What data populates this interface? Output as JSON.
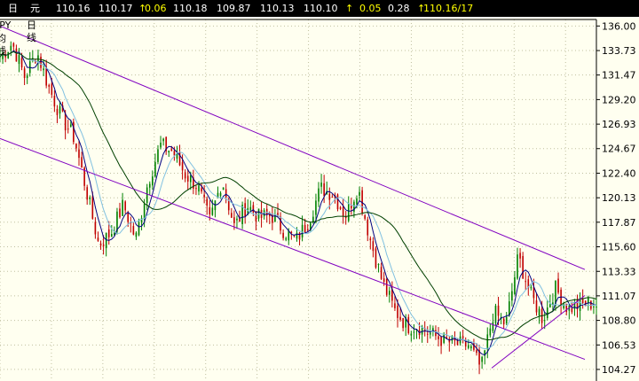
{
  "toolbar": {
    "period_glyph": "日",
    "currency_glyph": "元",
    "open": "110.16",
    "high": "110.17",
    "change_arrow": "↑",
    "change": "0.06",
    "prev": "110.18",
    "low": "109.87",
    "bid": "110.13",
    "ask": "110.10",
    "arrow2": "↑",
    "chg2": "0.05",
    "pct": "0.28",
    "arrow3": "↑",
    "last": "110.16/17"
  },
  "subheader": {
    "symbol": "JPY",
    "period": "日线",
    "ma_label": "均线"
  },
  "colors": {
    "background": "#FFFFF0",
    "up_candle": "#008000",
    "down_candle": "#C00000",
    "channel": "#8000C0",
    "ma_short": "#000080",
    "ma_medium": "#80C0E0",
    "ma_long": "#004000",
    "grid": "#C0C0A0",
    "toolbar_bg": "#000000",
    "toolbar_up": "#FFFF00"
  },
  "chart_data": {
    "type": "candlestick",
    "ylim": [
      103.2,
      136.6
    ],
    "y_ticks": [
      "136.00",
      "133.73",
      "131.47",
      "129.20",
      "126.93",
      "124.67",
      "122.40",
      "120.13",
      "117.87",
      "115.60",
      "113.33",
      "111.07",
      "108.80",
      "106.53",
      "104.27"
    ],
    "y_tick_values": [
      136.0,
      133.73,
      131.47,
      129.2,
      126.93,
      124.67,
      122.4,
      120.13,
      117.87,
      115.6,
      113.33,
      111.07,
      108.8,
      106.53,
      104.27
    ],
    "n_bars": 220,
    "price_path": [
      [
        0,
        133.2
      ],
      [
        6,
        134.4
      ],
      [
        12,
        131.3
      ],
      [
        18,
        133.6
      ],
      [
        24,
        130.2
      ],
      [
        30,
        127.5
      ],
      [
        36,
        125.7
      ],
      [
        42,
        120.8
      ],
      [
        48,
        115.8
      ],
      [
        54,
        116.9
      ],
      [
        60,
        119.5
      ],
      [
        66,
        116.3
      ],
      [
        72,
        121.6
      ],
      [
        78,
        125.0
      ],
      [
        84,
        124.4
      ],
      [
        90,
        122.3
      ],
      [
        96,
        121.2
      ],
      [
        102,
        118.0
      ],
      [
        108,
        121.8
      ],
      [
        114,
        117.4
      ],
      [
        120,
        119.5
      ],
      [
        126,
        118.3
      ],
      [
        132,
        118.5
      ],
      [
        138,
        117.1
      ],
      [
        144,
        116.2
      ],
      [
        150,
        118.0
      ],
      [
        156,
        121.0
      ],
      [
        162,
        120.5
      ],
      [
        168,
        118.5
      ],
      [
        174,
        121.1
      ],
      [
        180,
        116.3
      ],
      [
        186,
        112.3
      ],
      [
        192,
        109.7
      ],
      [
        198,
        108.3
      ],
      [
        204,
        108.2
      ],
      [
        210,
        107.5
      ],
      [
        216,
        106.9
      ],
      [
        222,
        106.6
      ],
      [
        228,
        106.5
      ],
      [
        234,
        104.3
      ],
      [
        240,
        109.6
      ],
      [
        246,
        108.4
      ],
      [
        252,
        114.7
      ],
      [
        258,
        111.2
      ],
      [
        264,
        108.9
      ],
      [
        270,
        111.8
      ],
      [
        276,
        109.9
      ],
      [
        282,
        110.2
      ],
      [
        288,
        110.4
      ],
      [
        290,
        110.2
      ]
    ],
    "channel_lines": [
      {
        "from": [
          0,
          136.0
        ],
        "to": [
          659,
          113.5
        ]
      },
      {
        "from": [
          0,
          125.6
        ],
        "to": [
          659,
          105.2
        ]
      },
      {
        "from": [
          554,
          104.4
        ],
        "to": [
          659,
          111.1
        ]
      }
    ],
    "moving_averages": [
      "short",
      "medium",
      "long"
    ],
    "grid": true
  }
}
